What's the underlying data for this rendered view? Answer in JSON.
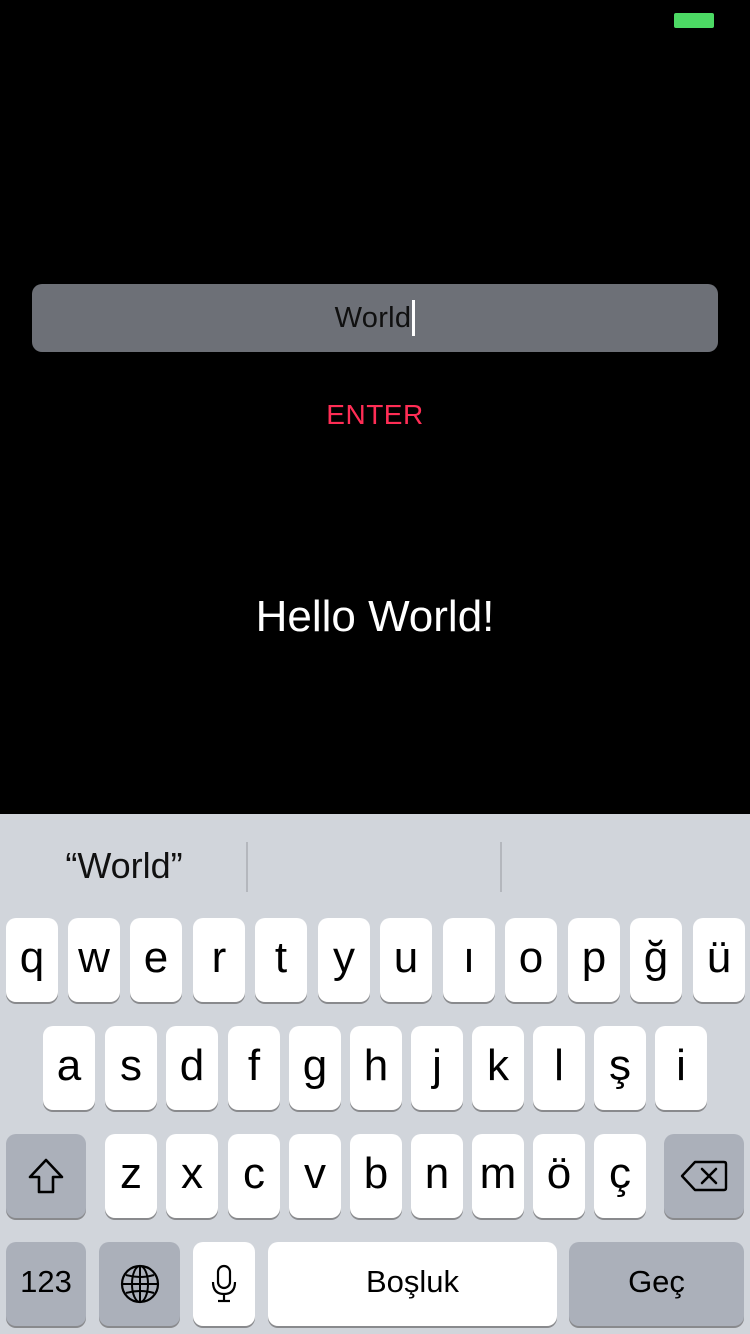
{
  "status": {
    "battery_color": "#4cd964"
  },
  "input": {
    "value": "World"
  },
  "enter_button": {
    "label": "ENTER",
    "color": "#ff2d55"
  },
  "greeting": {
    "text": "Hello World!"
  },
  "keyboard": {
    "suggestions": [
      "“World”",
      "",
      ""
    ],
    "row1": [
      "q",
      "w",
      "e",
      "r",
      "t",
      "y",
      "u",
      "ı",
      "o",
      "p",
      "ğ",
      "ü"
    ],
    "row2": [
      "a",
      "s",
      "d",
      "f",
      "g",
      "h",
      "j",
      "k",
      "l",
      "ş",
      "i"
    ],
    "row3": [
      "z",
      "x",
      "c",
      "v",
      "b",
      "n",
      "m",
      "ö",
      "ç"
    ],
    "numbers_label": "123",
    "space_label": "Boşluk",
    "return_label": "Geç",
    "icons": {
      "shift": "shift-icon",
      "delete": "backspace-icon",
      "globe": "globe-icon",
      "mic": "microphone-icon"
    }
  }
}
